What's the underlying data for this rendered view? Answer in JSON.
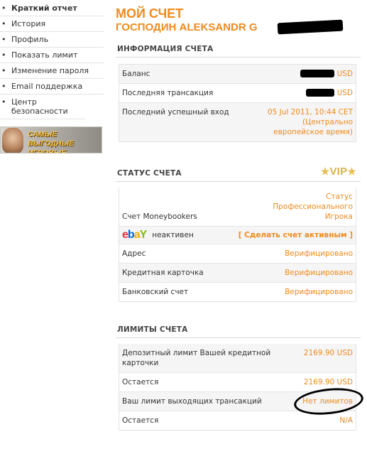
{
  "sidebar": {
    "items": [
      {
        "label": "Краткий отчет"
      },
      {
        "label": "История"
      },
      {
        "label": "Профиль"
      },
      {
        "label": "Показать лимит"
      },
      {
        "label": "Изменение пароля"
      },
      {
        "label": "Email поддержка"
      },
      {
        "label": "Центр безопасности"
      }
    ],
    "promo": {
      "text": "САМЫЕ ВЫГОДНЫЕ ИГРОВЫЕ ПРОМОЦИИ"
    }
  },
  "header": {
    "title": "МОЙ СЧЕТ",
    "name": "ГОСПОДИН ALEKSANDR G"
  },
  "account_info": {
    "heading": "ИНФОРМАЦИЯ СЧЕТА",
    "balance_label": "Баланс",
    "balance_currency": "USD",
    "last_tx_label": "Последняя трансакция",
    "last_tx_currency": "USD",
    "last_login_label": "Последний успешный вход",
    "last_login_value": "05 Jul 2011, 10:44 CET (Центрально европейское время)"
  },
  "account_status": {
    "heading": "СТАТУС СЧЕТА",
    "badge": "VIP",
    "moneybookers_label": "Счет Moneybookers",
    "moneybookers_value": "Статус Профессионального Игрока",
    "ebay_status": "неактивен",
    "ebay_link": "[ Сделать счет активным ]",
    "address_label": "Адрес",
    "address_value": "Верифицировано",
    "card_label": "Кредитная карточка",
    "card_value": "Верифицировано",
    "bank_label": "Банковский счет",
    "bank_value": "Верифицировано"
  },
  "account_limits": {
    "heading": "ЛИМИТЫ СЧЕТА",
    "deposit_label": "Депозитный лимит Вашей кредитной карточки",
    "deposit_value": "2169.90 USD",
    "remaining_label": "Остается",
    "remaining_value": "2169.90 USD",
    "outgoing_label": "Ваш лимит выходящих трансакций",
    "outgoing_value": "Нет лимитов",
    "remaining2_label": "Остается",
    "remaining2_value": "N/A"
  },
  "colors": {
    "accent": "#f08a1c",
    "vip": "#d9b44a"
  }
}
